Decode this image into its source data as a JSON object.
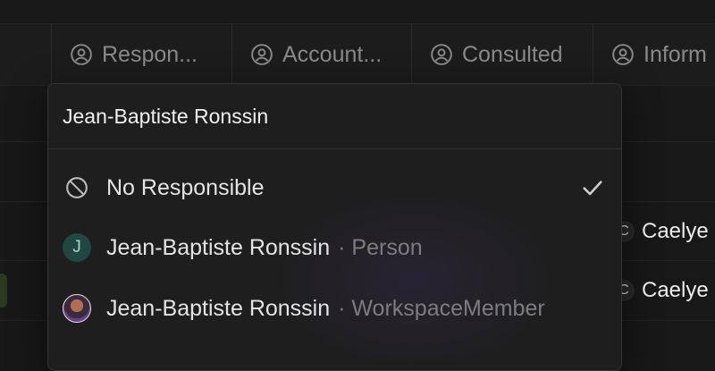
{
  "columns": [
    {
      "label": "Respon...",
      "icon": "user-circle-icon"
    },
    {
      "label": "Account...",
      "icon": "user-circle-icon"
    },
    {
      "label": "Consulted",
      "icon": "user-circle-icon"
    },
    {
      "label": "Inform",
      "icon": "user-circle-icon"
    }
  ],
  "rows": [
    {
      "chip": "Caelye"
    },
    {
      "chip": "Caelye"
    }
  ],
  "dropdown": {
    "search_value": "Jean-Baptiste Ronssin",
    "items": [
      {
        "label": "No Responsible",
        "detail": "",
        "icon": "no-entry-icon",
        "selected": true
      },
      {
        "label": "Jean-Baptiste Ronssin",
        "detail": "· Person",
        "avatar_letter": "J"
      },
      {
        "label": "Jean-Baptiste Ronssin",
        "detail": "· WorkspaceMember",
        "avatar": "photo"
      }
    ]
  },
  "colors": {
    "accent_avatar": "#214743",
    "check": "#cfcfcf"
  }
}
